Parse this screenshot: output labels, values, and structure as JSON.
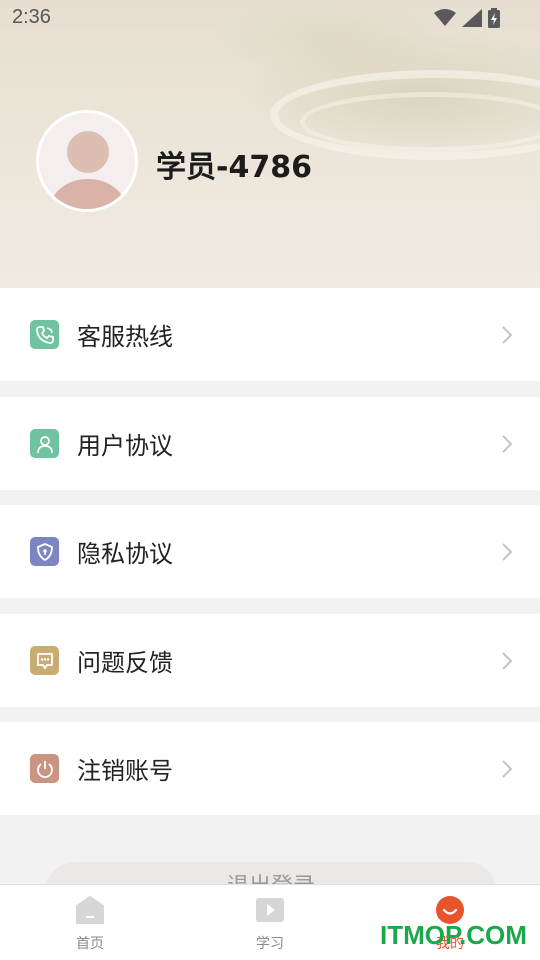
{
  "status_bar": {
    "time": "2:36"
  },
  "profile": {
    "username": "学员-4786"
  },
  "menu": {
    "items": [
      {
        "label": "客服热线",
        "icon": "phone-icon",
        "color": "#6fc3a0"
      },
      {
        "label": "用户协议",
        "icon": "user-icon",
        "color": "#6fc3a0"
      },
      {
        "label": "隐私协议",
        "icon": "shield-icon",
        "color": "#7d86c3"
      },
      {
        "label": "问题反馈",
        "icon": "chat-icon",
        "color": "#c9ac72"
      },
      {
        "label": "注销账号",
        "icon": "power-icon",
        "color": "#c99482"
      }
    ]
  },
  "logout_button": {
    "label": "退出登录"
  },
  "tabbar": {
    "tabs": [
      {
        "label": "首页",
        "icon": "home-icon",
        "active": false
      },
      {
        "label": "学习",
        "icon": "play-icon",
        "active": false
      },
      {
        "label": "我的",
        "icon": "profile-icon",
        "active": true
      }
    ],
    "active_color": "#e7532a"
  },
  "watermark": {
    "text": "ITMOP.COM"
  }
}
